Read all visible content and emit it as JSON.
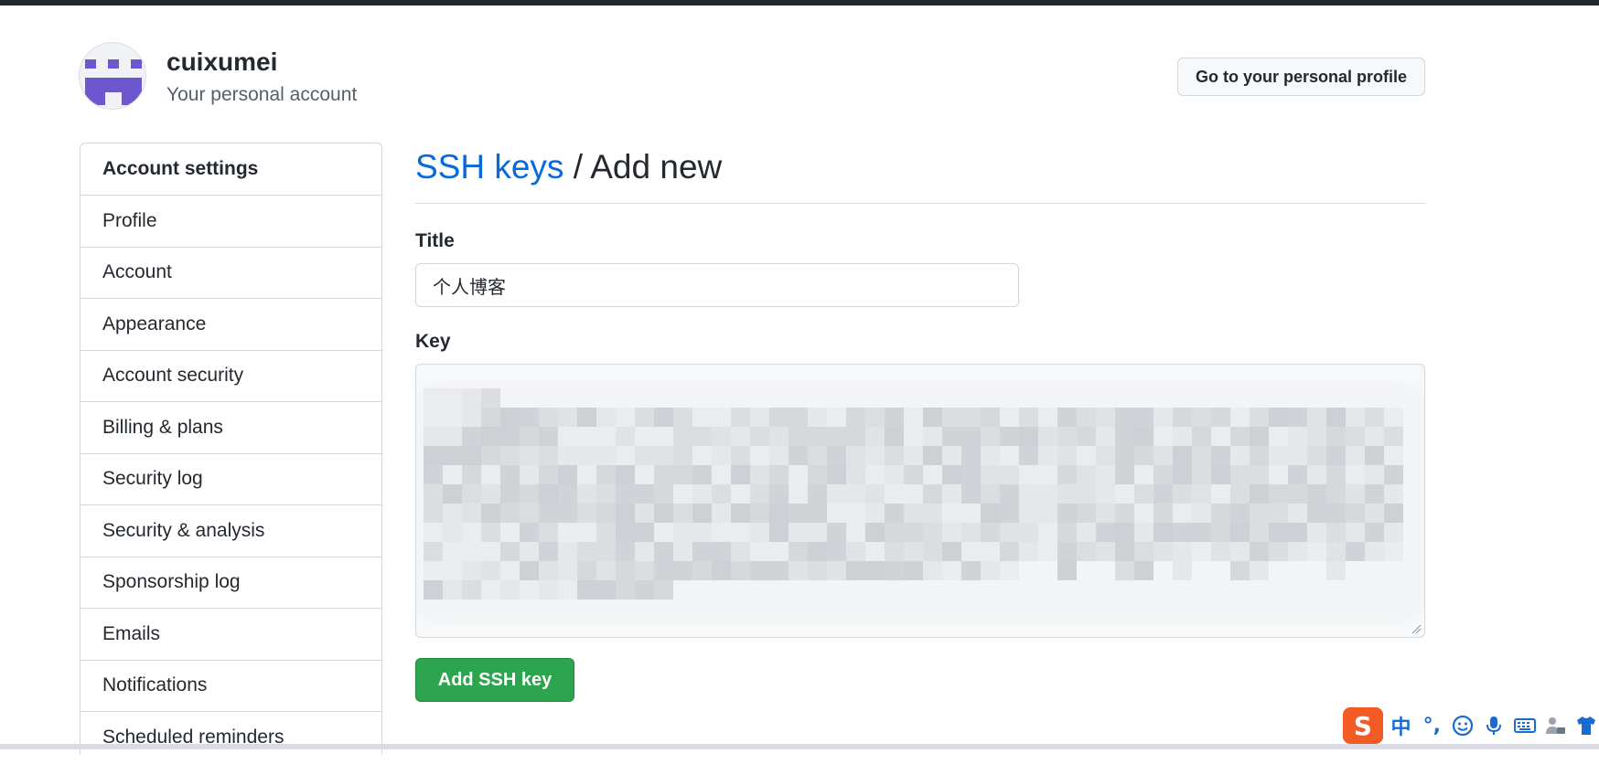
{
  "account": {
    "name": "cuixumei",
    "subtitle": "Your personal account",
    "profile_button": "Go to your personal profile"
  },
  "sidebar": {
    "heading": "Account settings",
    "items": [
      {
        "label": "Profile"
      },
      {
        "label": "Account"
      },
      {
        "label": "Appearance"
      },
      {
        "label": "Account security"
      },
      {
        "label": "Billing & plans"
      },
      {
        "label": "Security log"
      },
      {
        "label": "Security & analysis"
      },
      {
        "label": "Sponsorship log"
      },
      {
        "label": "Emails"
      },
      {
        "label": "Notifications"
      },
      {
        "label": "Scheduled reminders"
      }
    ]
  },
  "main": {
    "breadcrumb_link": "SSH keys",
    "breadcrumb_separator": " / ",
    "breadcrumb_current": "Add new",
    "title_label": "Title",
    "title_value": "个人博客",
    "key_label": "Key",
    "key_value": "",
    "submit_label": "Add SSH key"
  },
  "ime_toolbar": {
    "logo": "S",
    "mode": "中",
    "punct": "°,"
  },
  "colors": {
    "link": "#0969da",
    "primary_button": "#2da44e",
    "ime_logo": "#f25b23",
    "ime_icons": "#1a6bd1"
  }
}
